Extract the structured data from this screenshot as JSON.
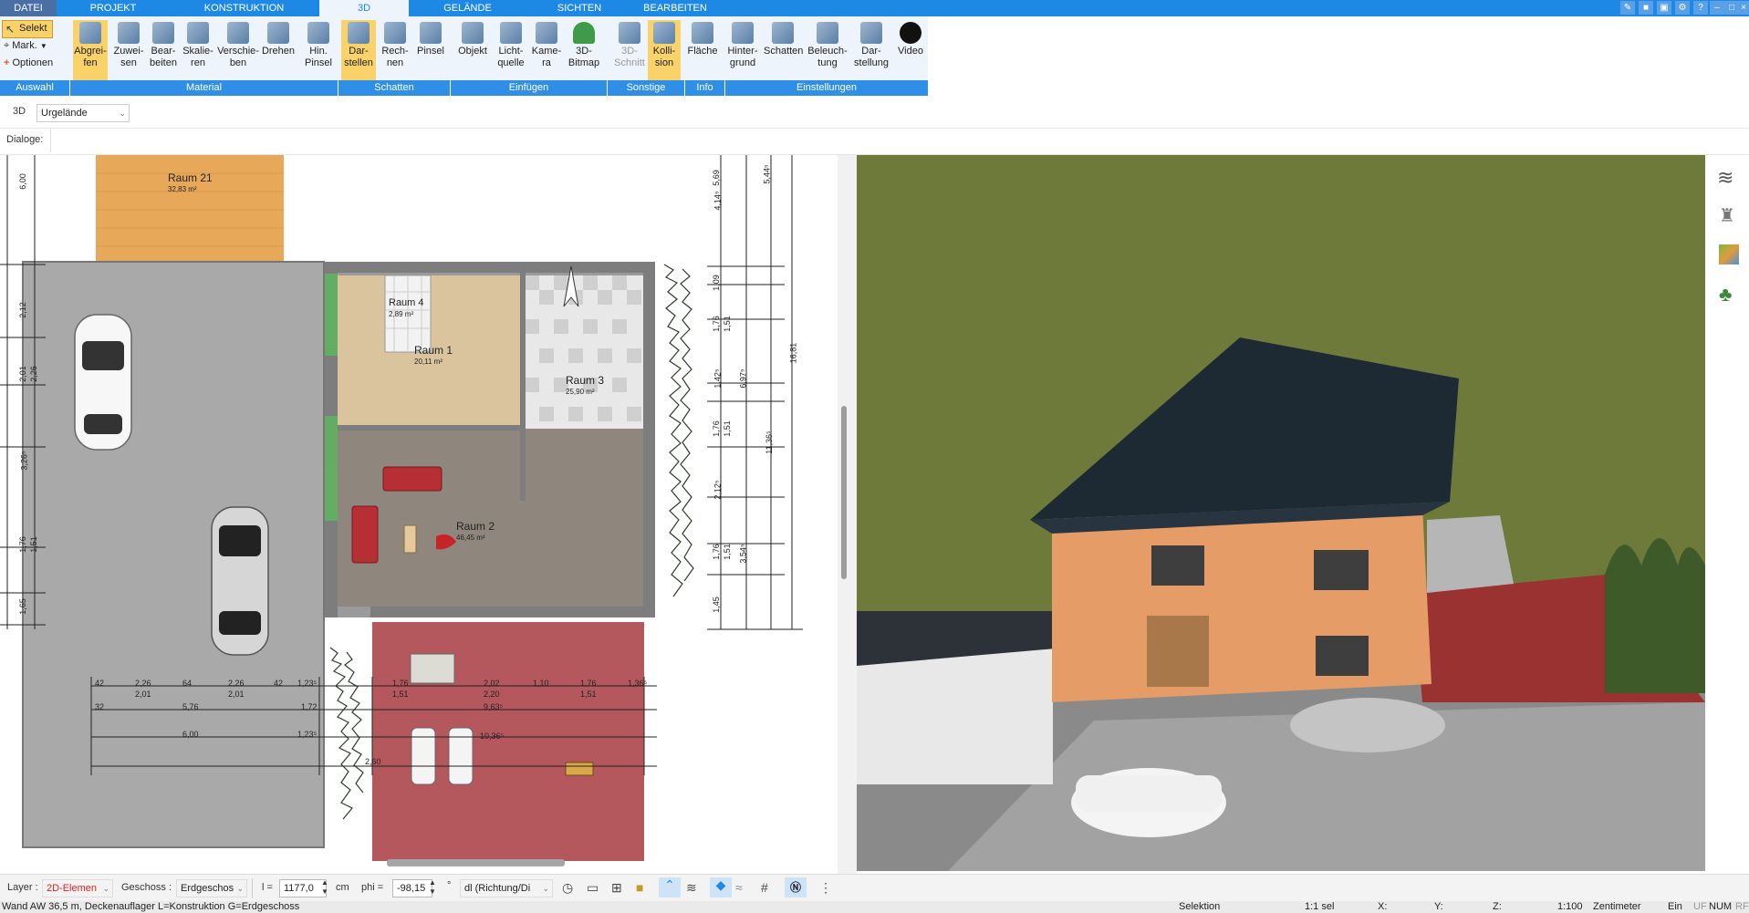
{
  "menu": {
    "tabs": [
      "DATEI",
      "PROJEKT",
      "KONSTRUKTION",
      "3D",
      "GELÄNDE",
      "SICHTEN",
      "BEARBEITEN"
    ]
  },
  "ribbon": {
    "auswahl": {
      "selekt": "Selekt",
      "mark": "Mark.",
      "optionen": "Optionen",
      "label": "Auswahl"
    },
    "buttons": [
      {
        "label": "Abgrei-\nfen",
        "name": "abgreifen"
      },
      {
        "label": "Zuwei-\nsen",
        "name": "zuweisen"
      },
      {
        "label": "Bear-\nbeiten",
        "name": "bearbeiten"
      },
      {
        "label": "Skalie-\nren",
        "name": "skalieren"
      },
      {
        "label": "Verschie-\nben",
        "name": "verschieben"
      },
      {
        "label": "Drehen",
        "name": "drehen"
      },
      {
        "label": "Hin.\nPinsel",
        "name": "hin-pinsel"
      },
      {
        "label": "Dar-\nstellen",
        "name": "darstellen"
      },
      {
        "label": "Rech-\nnen",
        "name": "rechnen"
      },
      {
        "label": "Pinsel",
        "name": "pinsel"
      },
      {
        "label": "Objekt",
        "name": "objekt"
      },
      {
        "label": "Licht-\nquelle",
        "name": "lichtquelle"
      },
      {
        "label": "Kame-\nra",
        "name": "kamera"
      },
      {
        "label": "3D-\nBitmap",
        "name": "3d-bitmap"
      },
      {
        "label": "3D-\nSchnitt",
        "name": "3d-schnitt"
      },
      {
        "label": "Kolli-\nsion",
        "name": "kollision"
      },
      {
        "label": "Fläche",
        "name": "flaeche"
      },
      {
        "label": "Hinter-\ngrund",
        "name": "hintergrund"
      },
      {
        "label": "Schatten",
        "name": "schatten"
      },
      {
        "label": "Beleuch-\ntung",
        "name": "beleuchtung"
      },
      {
        "label": "Dar-\nstellung",
        "name": "darstellung"
      },
      {
        "label": "Video",
        "name": "video"
      }
    ],
    "groups": [
      "Material",
      "Schatten",
      "Einfügen",
      "Sonstige",
      "Info",
      "Einstellungen"
    ]
  },
  "viewbar": {
    "mode": "3D",
    "terrain": "Urgelände"
  },
  "dialoge_label": "Dialoge:",
  "plan": {
    "rooms": [
      {
        "name": "Raum 21",
        "area": "32,83 m²"
      },
      {
        "name": "Raum 4",
        "area": "2,89 m²"
      },
      {
        "name": "Raum 1",
        "area": "20,11 m²"
      },
      {
        "name": "Raum 3",
        "area": "25,90 m²"
      },
      {
        "name": "Raum 2",
        "area": "46,45 m²"
      }
    ],
    "dims_right": [
      "5,69",
      "5,44⁵",
      "4,14⁵",
      "1,09",
      "1,76",
      "1,51",
      "6,97⁵",
      "1,42⁵",
      "16,81",
      "1,76",
      "1,51",
      "11,36⁵",
      "2,12⁵",
      "1,76",
      "1,51",
      "3,54⁵",
      "1,45"
    ],
    "dims_left": [
      "6,00",
      "2,12",
      "2,01",
      "2,26",
      "3,26⁵",
      "1,76",
      "1,51",
      "1,65"
    ],
    "dims_bottom": [
      "42",
      "2,26",
      "64",
      "2,26",
      "42",
      "1,23⁵",
      "2,01",
      "2,01",
      "32",
      "5,76",
      "1,72",
      "6,00",
      "1,23⁵",
      "1,76",
      "1,51",
      "2,02",
      "2,20",
      "1,10",
      "1,76",
      "1,51",
      "1,36⁵",
      "9,63⁵",
      "10,36⁵",
      "2,60"
    ]
  },
  "bottombar": {
    "layer_label": "Layer :",
    "layer_value": "2D-Elemen",
    "geschoss_label": "Geschoss :",
    "geschoss_value": "Erdgeschos",
    "l_label": "l =",
    "l_value": "1177,0",
    "cm": "cm",
    "phi_label": "phi =",
    "phi_value": "-98,15",
    "deg": "°",
    "dl_value": "dl (Richtung/Di"
  },
  "status": {
    "left": "Wand AW 36,5 m, Deckenauflager L=Konstruktion G=Erdgeschoss",
    "selektion": "Selektion",
    "sel": "1:1 sel",
    "x": "X:",
    "y": "Y:",
    "z": "Z:",
    "scale": "1:100",
    "unit": "Zentimeter",
    "ein": "Ein",
    "uf": "UF",
    "num": "NUM",
    "rf": "RF"
  },
  "colors": {
    "accent": "#1e88e5",
    "ribbon_bg": "#eef4fb",
    "active": "#f9d26a",
    "group": "#2f8fe6"
  }
}
